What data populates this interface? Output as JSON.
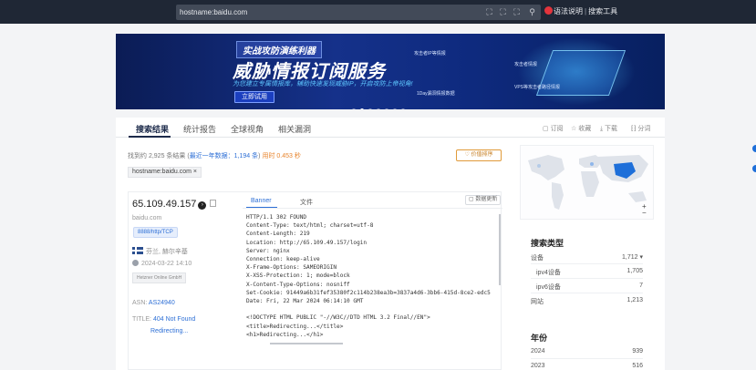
{
  "topbar": {
    "query": "hostname:baidu.com",
    "links": [
      "语法说明",
      "搜索工具"
    ],
    "icons": [
      "scan-icon",
      "target-icon",
      "capture-icon",
      "search-icon"
    ]
  },
  "banner": {
    "top_text": "实战攻防演练利器",
    "main_text": "威胁情报订阅服务",
    "sub_text": "为您建立专属情报库，辅助快速发现威胁IP，开启攻防上帝视角!",
    "button": "立即试用",
    "labels": [
      "攻击者IP等情报",
      "攻击者情报",
      "VPS等攻击者路径情报",
      "1Day漏洞情报数据"
    ],
    "slide_count": 7,
    "active_slide": 2
  },
  "tabs": [
    {
      "label": "搜索结果",
      "active": true
    },
    {
      "label": "统计报告",
      "active": false
    },
    {
      "label": "全球视角",
      "active": false
    },
    {
      "label": "相关漏洞",
      "active": false
    }
  ],
  "tools": [
    "订阅",
    "收藏",
    "下载",
    "分词"
  ],
  "stats": {
    "prefix": "找到约 2,925 条结果 (",
    "recent": "最近一年数据：1,194 条",
    "suffix": ")",
    "time": "用时 0.453 秒"
  },
  "sort_button": "价值排序",
  "filter_tag": "hostname:baidu.com ×",
  "result": {
    "ip": "65.109.49.157",
    "domain": "baidu.com",
    "port": "8888/http/TCP",
    "location": "芬兰, 赫尔辛基",
    "time": "2024-03-22 14:10",
    "org": "Hetzner Online GmbH",
    "asn_label": "ASN:",
    "asn": "AS24940",
    "title_label": "TITLE:",
    "title": "404 Not Found",
    "redirect": "Redirecting..."
  },
  "banner_panel": {
    "tabs": [
      "Banner",
      "文件"
    ],
    "refresh": "数据更新",
    "lines": [
      "HTTP/1.1 302 FOUND",
      "Content-Type: text/html; charset=utf-8",
      "Content-Length: 219",
      "Location: http://65.109.49.157/login",
      "Server: nginx",
      "Connection: keep-alive",
      "X-Frame-Options: SAMEORIGIN",
      "X-XSS-Protection: 1; mode=block",
      "X-Content-Type-Options: nosniff",
      "Set-Cookie: 91449a6b31fef35380f2c114b238ea3b=3837a4d6-3bb6-415d-8ce2-edc5",
      "Date: Fri, 22 Mar 2024 06:14:10 GMT",
      "",
      "<!DOCTYPE HTML PUBLIC \"-//W3C//DTD HTML 3.2 Final//EN\">",
      "<title>Redirecting...</title>",
      "<h1>Redirecting...</h1>"
    ]
  },
  "sidebar": {
    "search_type": {
      "heading": "搜索类型",
      "rows": [
        {
          "label": "设备",
          "value": "1,712 ▾"
        },
        {
          "label": "ipv4设备",
          "value": "1,705"
        },
        {
          "label": "ipv6设备",
          "value": "7"
        },
        {
          "label": "网站",
          "value": "1,213"
        }
      ]
    },
    "year": {
      "heading": "年份",
      "rows": [
        {
          "label": "2024",
          "value": "939"
        },
        {
          "label": "2023",
          "value": "516"
        }
      ]
    },
    "map_zoom": "+ -"
  },
  "colors": {
    "topbar": "#1f2735",
    "accent": "#2d6fd6",
    "highlight_country": "#1e6fd9",
    "orange": "#e8842c"
  }
}
